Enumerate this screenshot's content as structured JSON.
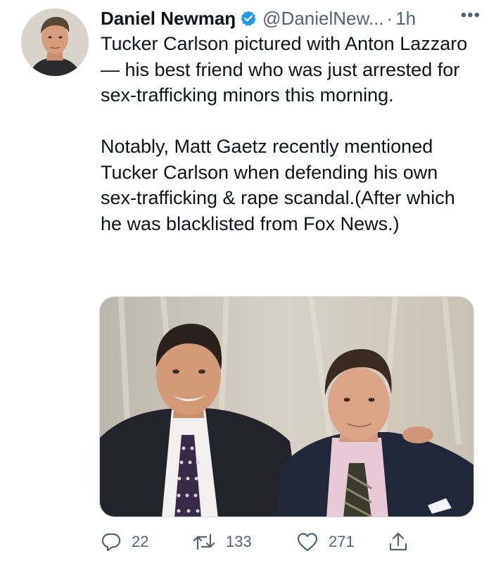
{
  "tweet": {
    "author_name": "Daniel Newmaŋ",
    "handle": "@DanielNew...",
    "separator": "·",
    "time": "1h",
    "more_label": "•••",
    "paragraph_1": "Tucker Carlson pictured with Anton Lazzaro — his best friend who was just arrested for sex-trafficking minors this morning.",
    "paragraph_2": "Notably, Matt Gaetz recently mentioned Tucker Carlson when defending his own sex-trafficking & rape scandal.(After which he was blacklisted from Fox News.)"
  },
  "icons": {
    "verified": "verified-badge-icon",
    "more": "more-icon",
    "reply": "reply-icon",
    "retweet": "retweet-icon",
    "like": "heart-icon",
    "share": "share-icon"
  },
  "colors": {
    "verified": "#1d9bf0",
    "meta_text": "#536471",
    "body_text": "#0f1419"
  },
  "actions": {
    "replies": "22",
    "retweets": "133",
    "likes": "271"
  }
}
